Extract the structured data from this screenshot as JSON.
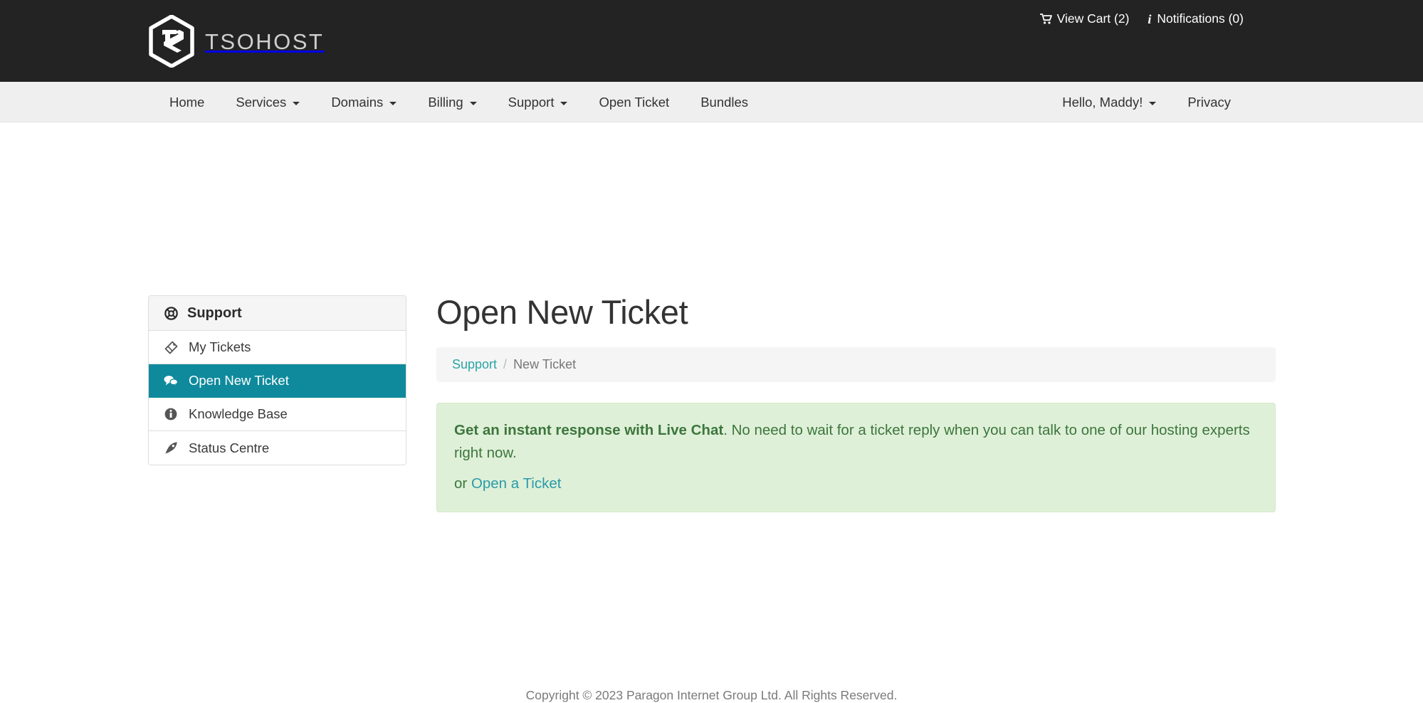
{
  "brand": {
    "name": "TSOHOST",
    "logo_icon": "tsohost-hexagon-logo",
    "header_bg": "#232323",
    "accent": "#0f8a9c",
    "link_color": "#2aa4a4"
  },
  "topbar": {
    "cart": {
      "label": "View Cart (2)",
      "icon": "shopping-cart-icon"
    },
    "notifications": {
      "label": "Notifications (0)",
      "icon": "info-icon"
    }
  },
  "nav": {
    "left_items": [
      {
        "label": "Home",
        "has_caret": false
      },
      {
        "label": "Services",
        "has_caret": true
      },
      {
        "label": "Domains",
        "has_caret": true
      },
      {
        "label": "Billing",
        "has_caret": true
      },
      {
        "label": "Support",
        "has_caret": true
      },
      {
        "label": "Open Ticket",
        "has_caret": false
      },
      {
        "label": "Bundles",
        "has_caret": false
      }
    ],
    "right_items": [
      {
        "label": "Hello, Maddy!",
        "has_caret": true
      },
      {
        "label": "Privacy",
        "has_caret": false
      }
    ]
  },
  "sidebar": {
    "header": {
      "label": "Support",
      "icon": "life-ring-icon"
    },
    "items": [
      {
        "label": "My Tickets",
        "icon": "ticket-icon",
        "active": false
      },
      {
        "label": "Open New Ticket",
        "icon": "comments-icon",
        "active": true
      },
      {
        "label": "Knowledge Base",
        "icon": "info-circle-icon",
        "active": false
      },
      {
        "label": "Status Centre",
        "icon": "rocket-icon",
        "active": false
      }
    ]
  },
  "main": {
    "title": "Open New Ticket",
    "breadcrumb": {
      "root": "Support",
      "separator": "/",
      "current": "New Ticket"
    },
    "alert": {
      "headline": "Get an instant response with Live Chat",
      "body": ". No need to wait for a ticket reply when you can talk to one of our hosting experts right now.",
      "or_prefix": "or ",
      "link_label": "Open a Ticket",
      "bg_color": "#dff0d8",
      "text_color": "#3c763d"
    }
  },
  "footer": {
    "copyright": "Copyright © 2023 Paragon Internet Group Ltd. All Rights Reserved."
  }
}
